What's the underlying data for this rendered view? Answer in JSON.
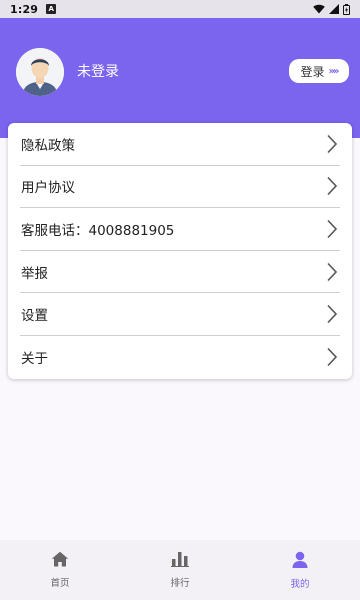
{
  "status_bar": {
    "time": "1:29",
    "notification_icon": "A"
  },
  "profile": {
    "username": "未登录",
    "login_label": "登录",
    "login_chevrons": "»»"
  },
  "menu": {
    "items": [
      {
        "label": "隐私政策"
      },
      {
        "label": "用户协议"
      },
      {
        "label": "客服电话：4008881905"
      },
      {
        "label": "举报"
      },
      {
        "label": "设置"
      },
      {
        "label": "关于"
      }
    ]
  },
  "bottom_nav": {
    "items": [
      {
        "label": "首页",
        "icon": "home-icon",
        "active": false
      },
      {
        "label": "排行",
        "icon": "bar-chart-icon",
        "active": false
      },
      {
        "label": "我的",
        "icon": "person-icon",
        "active": true
      }
    ]
  },
  "colors": {
    "accent": "#7b64ee",
    "header_bg": "#7b64ee",
    "page_bg": "#fbf8fd",
    "nav_inactive": "#666666"
  }
}
